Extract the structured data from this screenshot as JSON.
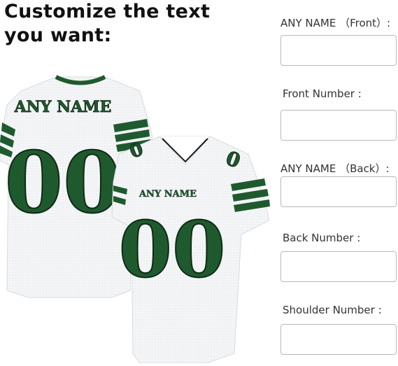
{
  "headline": {
    "line1": "Customize the text",
    "line2": "you want:"
  },
  "form": {
    "fields": [
      {
        "label": "ANY NAME （Front）:",
        "value": ""
      },
      {
        "label": "Front Number :",
        "value": ""
      },
      {
        "label": "ANY NAME （Back）:",
        "value": ""
      },
      {
        "label": "Back Number :",
        "value": ""
      },
      {
        "label": "Shoulder Number :",
        "value": ""
      }
    ]
  },
  "jersey_back": {
    "name": "ANY NAME",
    "number": "00"
  },
  "jersey_front": {
    "name": "ANY NAME",
    "number": "00",
    "shoulder_number": "0"
  },
  "colors": {
    "jersey_body": "#f4f5f7",
    "trim_green": "#1f5a2e",
    "outline_dark": "#0f2a16",
    "input_border": "#b9b9b9"
  }
}
